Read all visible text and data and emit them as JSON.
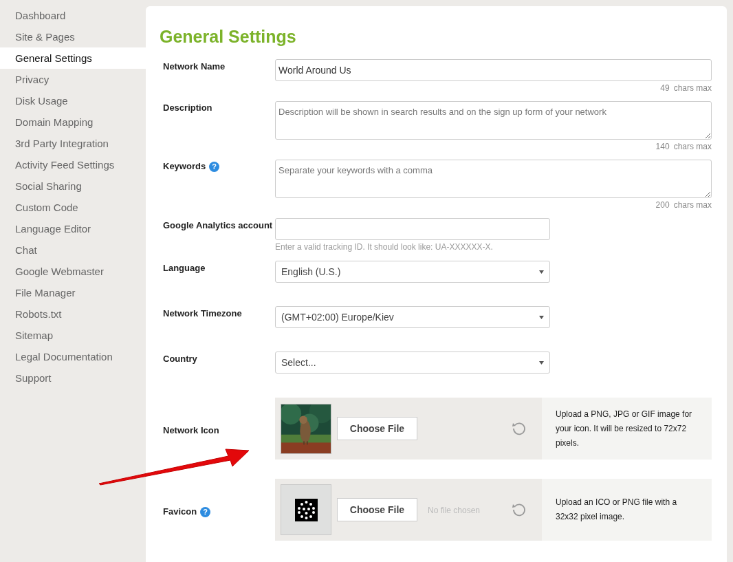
{
  "sidebar": {
    "items": [
      {
        "label": "Dashboard",
        "selected": false
      },
      {
        "label": "Site & Pages",
        "selected": false
      },
      {
        "label": "General Settings",
        "selected": true
      },
      {
        "label": "Privacy",
        "selected": false
      },
      {
        "label": "Disk Usage",
        "selected": false
      },
      {
        "label": "Domain Mapping",
        "selected": false
      },
      {
        "label": "3rd Party Integration",
        "selected": false
      },
      {
        "label": "Activity Feed Settings",
        "selected": false
      },
      {
        "label": "Social Sharing",
        "selected": false
      },
      {
        "label": "Custom Code",
        "selected": false
      },
      {
        "label": "Language Editor",
        "selected": false
      },
      {
        "label": "Chat",
        "selected": false
      },
      {
        "label": "Google Webmaster",
        "selected": false
      },
      {
        "label": "File Manager",
        "selected": false
      },
      {
        "label": "Robots.txt",
        "selected": false
      },
      {
        "label": "Sitemap",
        "selected": false
      },
      {
        "label": "Legal Documentation",
        "selected": false
      },
      {
        "label": "Support",
        "selected": false
      }
    ]
  },
  "page": {
    "title": "General Settings"
  },
  "fields": [
    {
      "kind": "text",
      "label": "Network Name",
      "value": "World Around Us",
      "counter": "49",
      "counter_unit": "chars max"
    },
    {
      "kind": "textarea",
      "label": "Description",
      "placeholder": "Description will be shown in search results and on the sign up form of your network",
      "counter": "140",
      "counter_unit": "chars max"
    },
    {
      "kind": "textarea",
      "label": "Keywords",
      "help": "?",
      "placeholder": "Separate your keywords with a comma",
      "counter": "200",
      "counter_unit": "chars max"
    },
    {
      "kind": "short",
      "label": "Google Analytics account",
      "hint": "Enter a valid tracking ID. It should look like: UA-XXXXXX-X."
    },
    {
      "kind": "select",
      "label": "Language",
      "value": "English (U.S.)"
    },
    {
      "kind": "select",
      "label": "Network Timezone",
      "value": "(GMT+02:00) Europe/Kiev"
    },
    {
      "kind": "select",
      "label": "Country",
      "value": "Select..."
    },
    {
      "kind": "upload",
      "label": "Network Icon",
      "button": "Choose File",
      "info": "Upload a PNG, JPG or GIF image for your icon. It will be resized to 72x72 pixels."
    },
    {
      "kind": "upload",
      "label": "Favicon",
      "help": "?",
      "preview": {
        "kind": "icon"
      },
      "button": "Choose File",
      "status": "No file chosen",
      "info": "Upload an ICO or PNG file with a 32x32 pixel image."
    }
  ]
}
